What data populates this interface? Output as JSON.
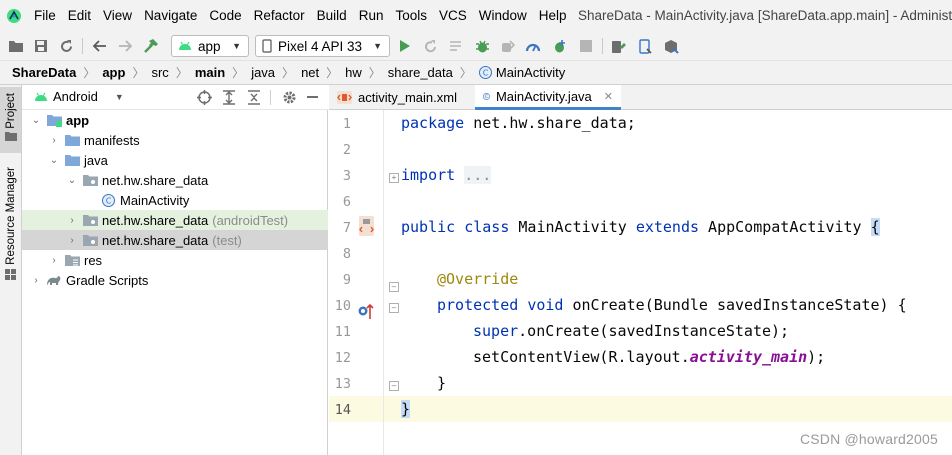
{
  "menubar": {
    "items": [
      "File",
      "Edit",
      "View",
      "Navigate",
      "Code",
      "Refactor",
      "Build",
      "Run",
      "Tools",
      "VCS",
      "Window",
      "Help"
    ],
    "window_title": "ShareData - MainActivity.java [ShareData.app.main] - Administrat"
  },
  "toolbar": {
    "module_combo": "app",
    "device_combo": "Pixel 4 API 33",
    "icons": [
      "folder-open-icon",
      "save-icon",
      "sync-icon",
      "back-icon",
      "forward-icon",
      "build-hammer-icon",
      "run-icon",
      "rerun-icon",
      "apply-changes-icon",
      "debug-icon",
      "attach-debugger-icon",
      "profile-icon",
      "apply-code-changes-icon",
      "stop-icon",
      "device-manager-icon",
      "emulator-icon",
      "sdk-manager-icon"
    ]
  },
  "breadcrumb": [
    "ShareData",
    "app",
    "src",
    "main",
    "java",
    "net",
    "hw",
    "share_data",
    "MainActivity"
  ],
  "sidebar": {
    "project_tab": "Project",
    "resource_manager_tab": "Resource Manager"
  },
  "project_panel": {
    "view_mode": "Android",
    "tree": [
      {
        "label": "app",
        "suffix": "",
        "level": 0,
        "expanded": true
      },
      {
        "label": "manifests",
        "suffix": "",
        "level": 1,
        "expanded": false
      },
      {
        "label": "java",
        "suffix": "",
        "level": 1,
        "expanded": true
      },
      {
        "label": "net.hw.share_data",
        "suffix": "",
        "level": 2,
        "expanded": true
      },
      {
        "label": "MainActivity",
        "suffix": "",
        "level": 3,
        "expanded": false
      },
      {
        "label": "net.hw.share_data",
        "suffix": "(androidTest)",
        "level": 2,
        "expanded": false
      },
      {
        "label": "net.hw.share_data",
        "suffix": "(test)",
        "level": 2,
        "expanded": false
      },
      {
        "label": "res",
        "suffix": "",
        "level": 1,
        "expanded": false
      },
      {
        "label": "Gradle Scripts",
        "suffix": "",
        "level": 0,
        "expanded": false
      }
    ]
  },
  "editor": {
    "tabs": [
      {
        "label": "activity_main.xml",
        "active": false
      },
      {
        "label": "MainActivity.java",
        "active": true
      }
    ],
    "line_numbers": [
      "1",
      "2",
      "3",
      "6",
      "7",
      "8",
      "9",
      "10",
      "11",
      "12",
      "13",
      "14"
    ],
    "code": {
      "l1_kw": "package",
      "l1_rest": " net.hw.share_data;",
      "l3_kw": "import",
      "l3_fold": "...",
      "l7_kw1": "public",
      "l7_kw2": "class",
      "l7_name": " MainActivity ",
      "l7_kw3": "extends",
      "l7_super": " AppCompatActivity ",
      "l7_brace": "{",
      "l9_ann": "@Override",
      "l10_kw1": "protected",
      "l10_kw2": "void",
      "l10_rest": " onCreate(Bundle savedInstanceState) {",
      "l11_kw": "super",
      "l11_rest": ".onCreate(savedInstanceState);",
      "l12_a": "setContentView(R.layout.",
      "l12_it": "activity_main",
      "l12_b": ");",
      "l13": "}",
      "l14": "}"
    }
  },
  "watermark": "CSDN @howard2005",
  "colors": {
    "keyword": "#0033b3",
    "annotation": "#9e880d",
    "italic_field": "#871094",
    "current_line": "#fcfae1",
    "accent": "#4083c9"
  }
}
